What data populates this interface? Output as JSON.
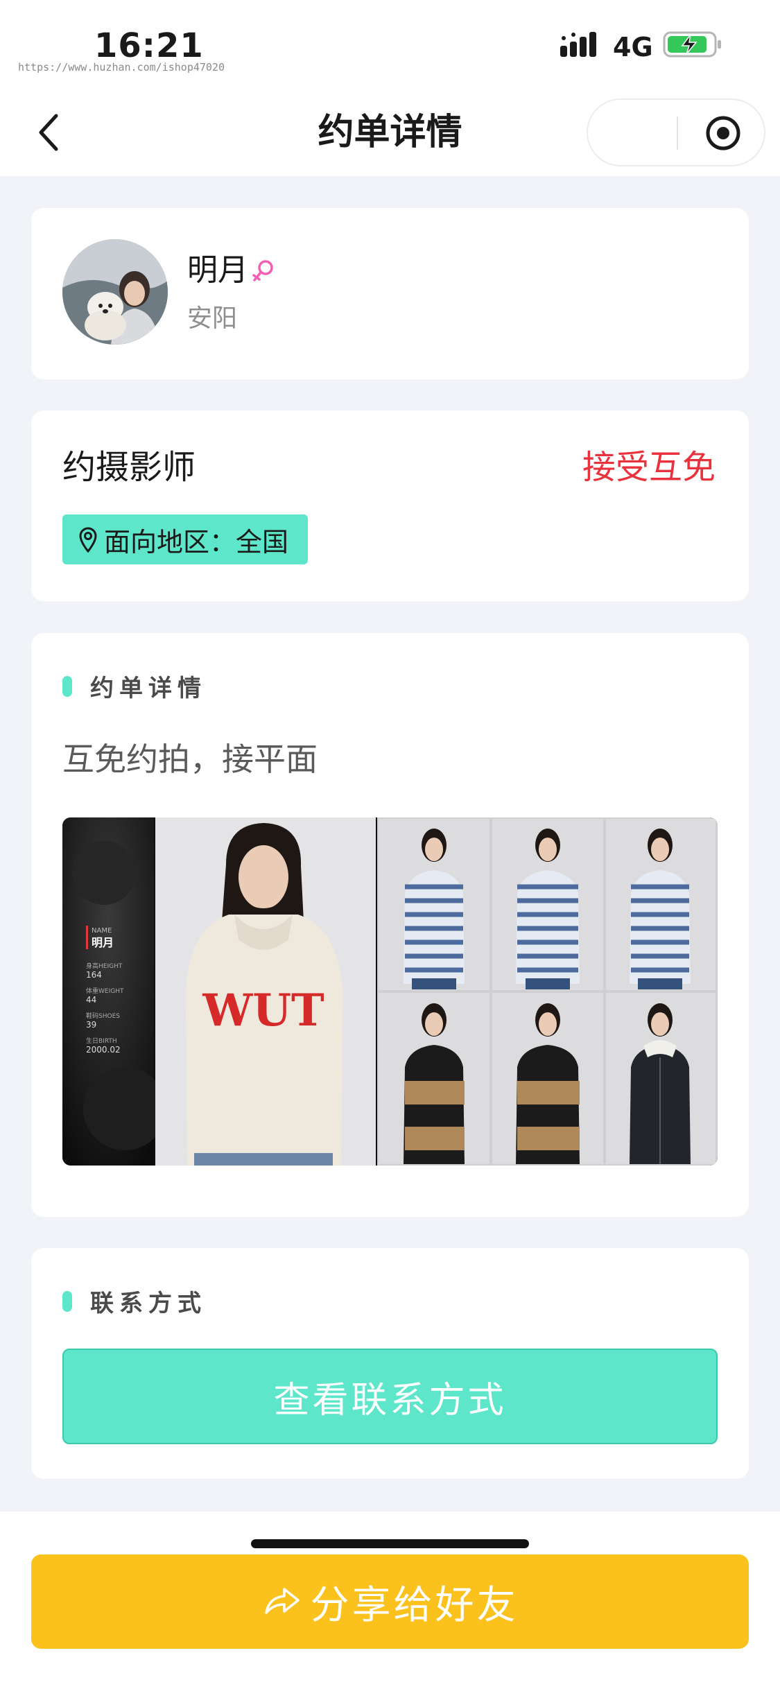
{
  "status_bar": {
    "time": "16:21",
    "watermark": "https://www.huzhan.com/ishop47020",
    "network": "4G",
    "battery_icon": "battery-charging-icon",
    "signal_icon": "cellular-signal-icon"
  },
  "nav": {
    "title": "约单详情",
    "back_icon": "chevron-left-icon",
    "record_icon": "record-icon"
  },
  "profile": {
    "name": "明月",
    "gender_icon": "female-icon",
    "city": "安阳"
  },
  "order_type": {
    "title": "约摄影师",
    "status": "接受互免",
    "area_label": "面向地区：全国",
    "area_icon": "map-pin-icon"
  },
  "detail": {
    "section_title": "约单详情",
    "text": "互免约拍，接平面",
    "composite": {
      "name_label": "NAME",
      "name": "明月",
      "stats": [
        {
          "label": "身高HEIGHT",
          "value": "164"
        },
        {
          "label": "体重WEIGHT",
          "value": "44"
        },
        {
          "label": "鞋码SHOES",
          "value": "39"
        },
        {
          "label": "生日BIRTH",
          "value": "2000.02"
        }
      ],
      "hero_text": "WUT"
    }
  },
  "contact": {
    "section_title": "联系方式",
    "button_label": "查看联系方式"
  },
  "share": {
    "button_label": "分享给好友",
    "icon": "share-arrow-icon"
  },
  "colors": {
    "accent": "#5de6c9",
    "status_red": "#e8333e",
    "share_yellow": "#fbc21e",
    "page_bg": "#f2f3f8"
  }
}
